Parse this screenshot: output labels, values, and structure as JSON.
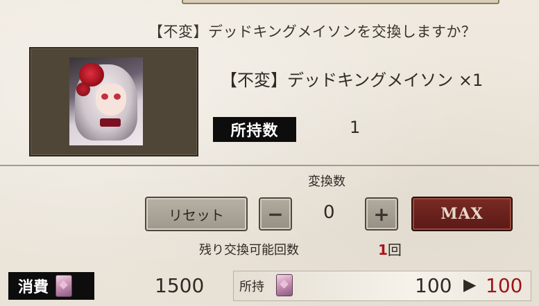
{
  "dialog": {
    "question": "【不変】デッドキングメイソンを交換しますか？",
    "item_name": "【不変】デッドキングメイソン ×1",
    "owned_label": "所持数",
    "owned_value": "1"
  },
  "exchange": {
    "label": "変換数",
    "reset_label": "リセット",
    "minus_label": "−",
    "count": "0",
    "plus_label": "+",
    "max_label": "MAX",
    "remaining_label": "残り交換可能回数",
    "remaining_count": "1",
    "remaining_unit": "回"
  },
  "cost": {
    "label": "消費",
    "icon": "card-icon",
    "value": "1500",
    "have_label": "所持",
    "have_before": "100",
    "arrow": "▶",
    "have_after": "100",
    "after_color": "#9c1418"
  },
  "colors": {
    "background": "#ece6dc",
    "max_button": "#6a221d",
    "label_bg": "#0d0d0d"
  }
}
